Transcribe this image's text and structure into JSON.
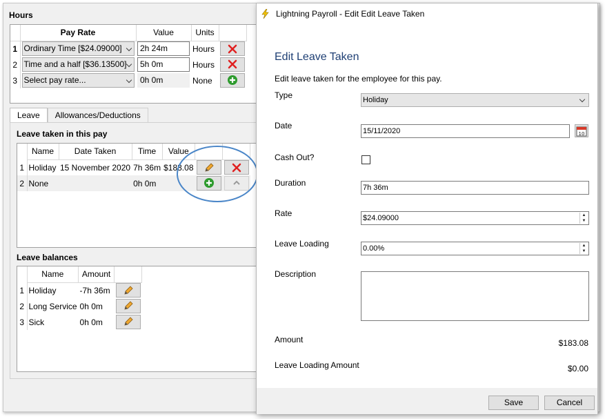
{
  "hours": {
    "title": "Hours",
    "columns": [
      "Pay Rate",
      "Value",
      "Units"
    ],
    "rows": [
      {
        "num": "1",
        "pay_rate": "Ordinary Time [$24.09000]",
        "value": "2h 24m",
        "units": "Hours",
        "action": "delete-icon"
      },
      {
        "num": "2",
        "pay_rate": "Time and a half [$36.13500]",
        "value": "5h 0m",
        "units": "Hours",
        "action": "delete-icon"
      },
      {
        "num": "3",
        "pay_rate": "Select pay rate...",
        "value": "0h 0m",
        "units": "None",
        "action": "add-icon"
      }
    ]
  },
  "tabs": [
    {
      "label": "Leave",
      "active": true
    },
    {
      "label": "Allowances/Deductions",
      "active": false
    }
  ],
  "leave_taken": {
    "title": "Leave taken in this pay",
    "columns": [
      "Name",
      "Date Taken",
      "Time",
      "Value"
    ],
    "rows": [
      {
        "num": "1",
        "name": "Holiday",
        "date": "15 November 2020",
        "time": "7h 36m",
        "value": "$183.08"
      },
      {
        "num": "2",
        "name": "None",
        "date": "",
        "time": "0h 0m",
        "value": ""
      }
    ]
  },
  "leave_balances": {
    "title": "Leave balances",
    "columns": [
      "Name",
      "Amount"
    ],
    "rows": [
      {
        "num": "1",
        "name": "Holiday",
        "amount": "-7h 36m"
      },
      {
        "num": "2",
        "name": "Long Service",
        "amount": "0h 0m"
      },
      {
        "num": "3",
        "name": "Sick",
        "amount": "0h 0m"
      }
    ]
  },
  "dialog": {
    "window_title": "Lightning Payroll - Edit Edit Leave Taken",
    "heading": "Edit Leave Taken",
    "subtitle": "Edit leave taken for the employee for this pay.",
    "labels": {
      "type": "Type",
      "date": "Date",
      "cash_out": "Cash Out?",
      "duration": "Duration",
      "rate": "Rate",
      "leave_loading": "Leave Loading",
      "description": "Description",
      "amount": "Amount",
      "leave_loading_amount": "Leave Loading Amount"
    },
    "values": {
      "type": "Holiday",
      "date": "15/11/2020",
      "cash_out": false,
      "duration": "7h 36m",
      "rate": "$24.09000",
      "leave_loading": "0.00%",
      "description": "",
      "amount": "$183.08",
      "leave_loading_amount": "$0.00"
    },
    "buttons": {
      "save": "Save",
      "cancel": "Cancel"
    }
  },
  "colors": {
    "heading_blue": "#1e3f74",
    "highlight_circle": "#4a86c8",
    "delete_red": "#e02020",
    "add_green": "#2e9b2e"
  }
}
